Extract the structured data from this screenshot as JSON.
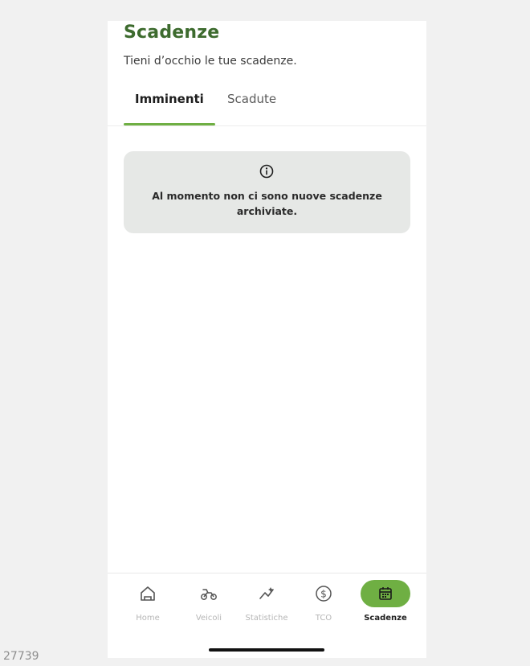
{
  "header": {
    "title": "Scadenze",
    "subtitle": "Tieni d’occhio le tue scadenze."
  },
  "tabs": [
    {
      "label": "Imminenti",
      "active": true
    },
    {
      "label": "Scadute",
      "active": false
    }
  ],
  "empty_state": {
    "icon": "info-icon",
    "message": "Al momento non ci sono nuove scadenze archiviate."
  },
  "bottom_nav": [
    {
      "label": "Home",
      "icon": "home-icon",
      "active": false
    },
    {
      "label": "Veicoli",
      "icon": "motorbike-icon",
      "active": false
    },
    {
      "label": "Statistiche",
      "icon": "stats-icon",
      "active": false
    },
    {
      "label": "TCO",
      "icon": "dollar-circle-icon",
      "active": false
    },
    {
      "label": "Scadenze",
      "icon": "calendar-icon",
      "active": true
    }
  ],
  "colors": {
    "brand_green": "#6faf43",
    "title_green": "#3d6b2e",
    "card_bg": "#e6e8e6"
  },
  "corner_id": "27739"
}
